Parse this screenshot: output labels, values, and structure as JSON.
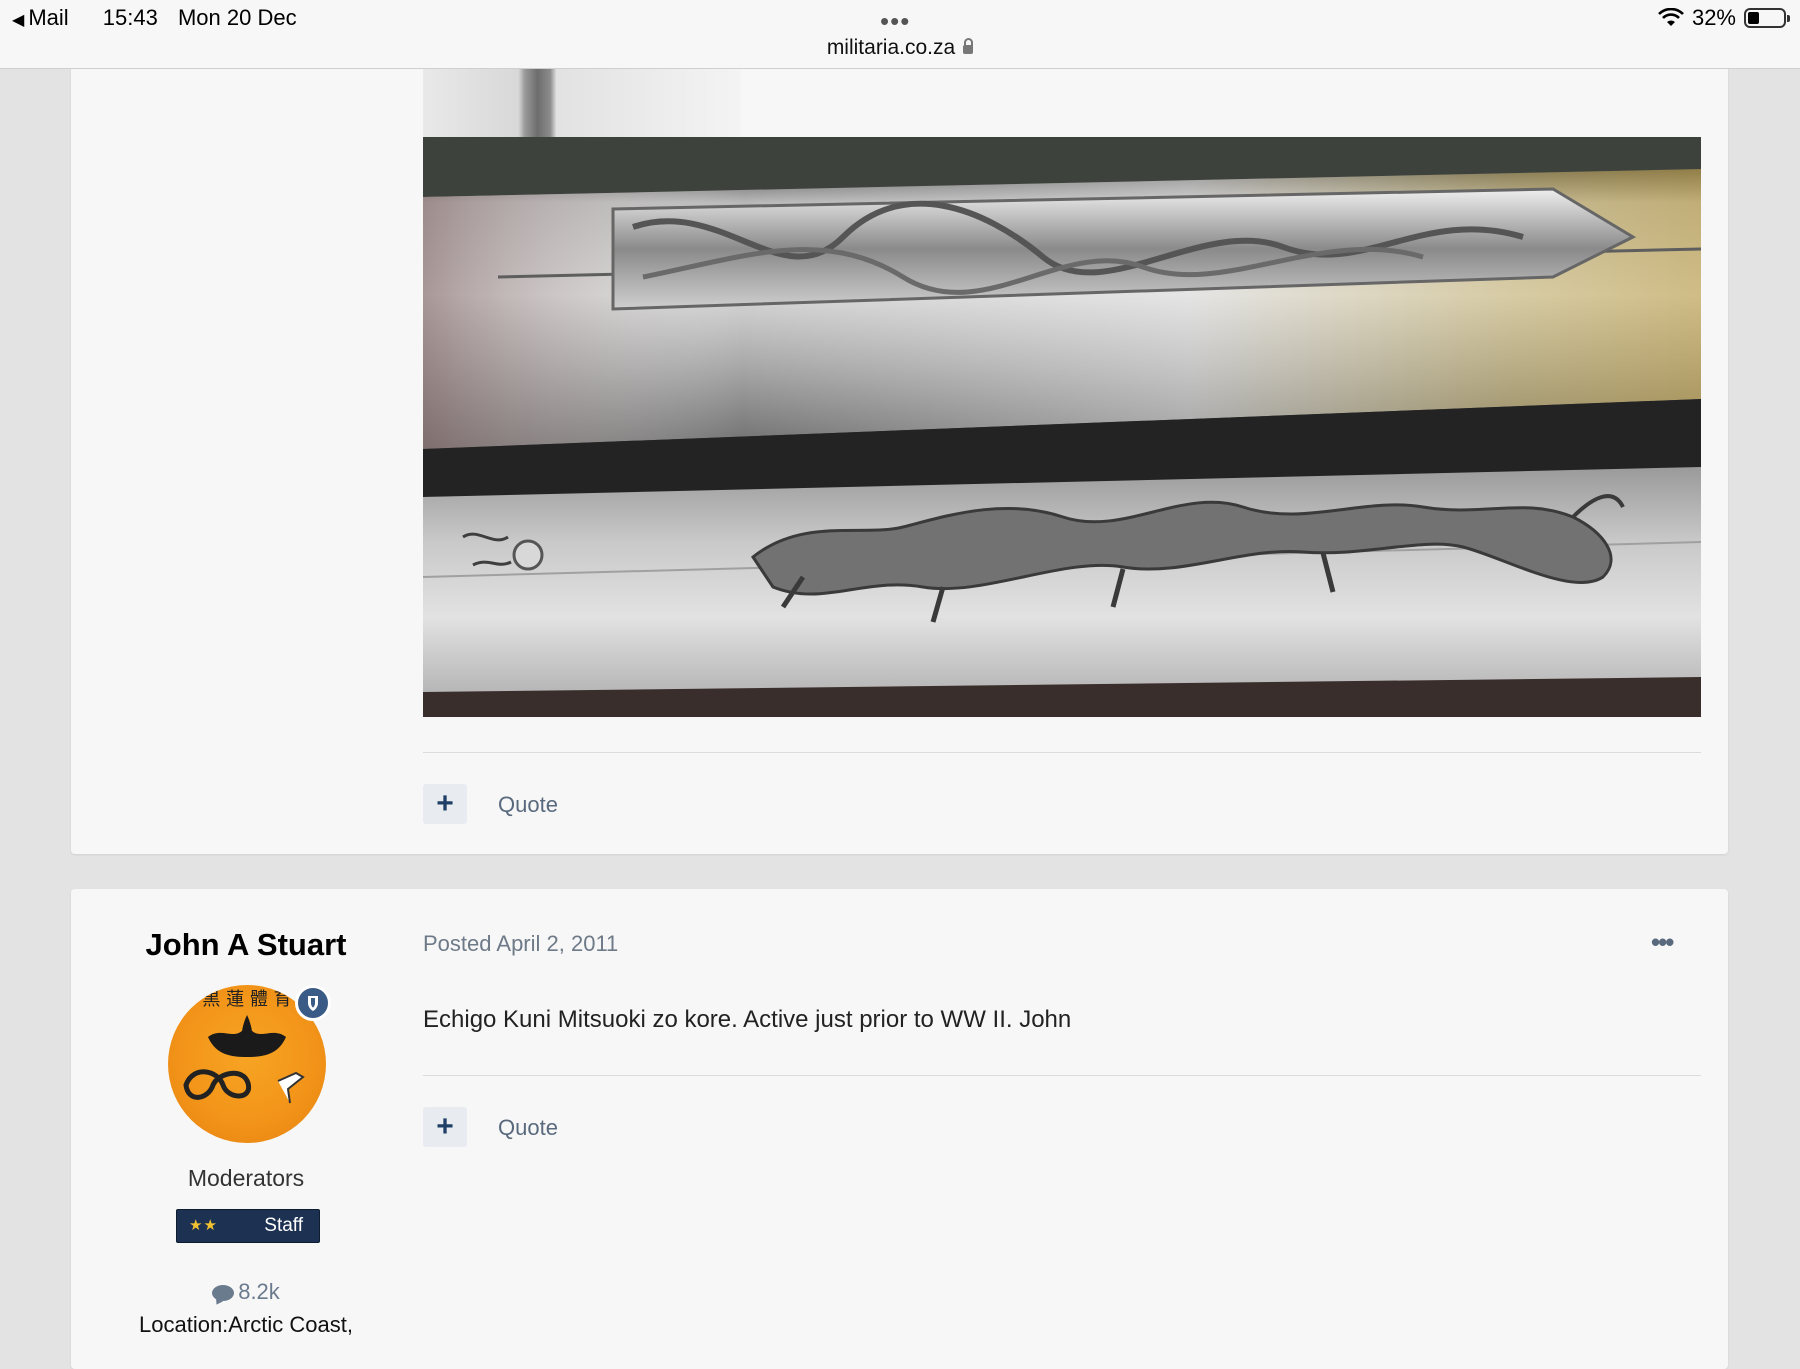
{
  "status_bar": {
    "back_app": "Mail",
    "time": "15:43",
    "date": "Mon 20 Dec",
    "url": "militaria.co.za",
    "battery": "32%",
    "battery_level": 0.32
  },
  "posts": [
    {
      "reaction_symbol": "+",
      "quote_label": "Quote"
    },
    {
      "author": "John A Stuart",
      "group": "Moderators",
      "badge_label": "Staff",
      "badge_stars": "★★",
      "post_count": "8.2k",
      "location": "Location:Arctic Coast,",
      "posted": "Posted April 2, 2011",
      "body": "Echigo Kuni Mitsuoki zo kore. Active just prior to WW II. John",
      "reaction_symbol": "+",
      "quote_label": "Quote"
    }
  ],
  "colors": {
    "page_bg": "#e3e3e3",
    "card_bg": "#f7f7f7",
    "link": "#5a6a7e",
    "staff_badge": "#1d3252",
    "avatar": "#f29318"
  }
}
